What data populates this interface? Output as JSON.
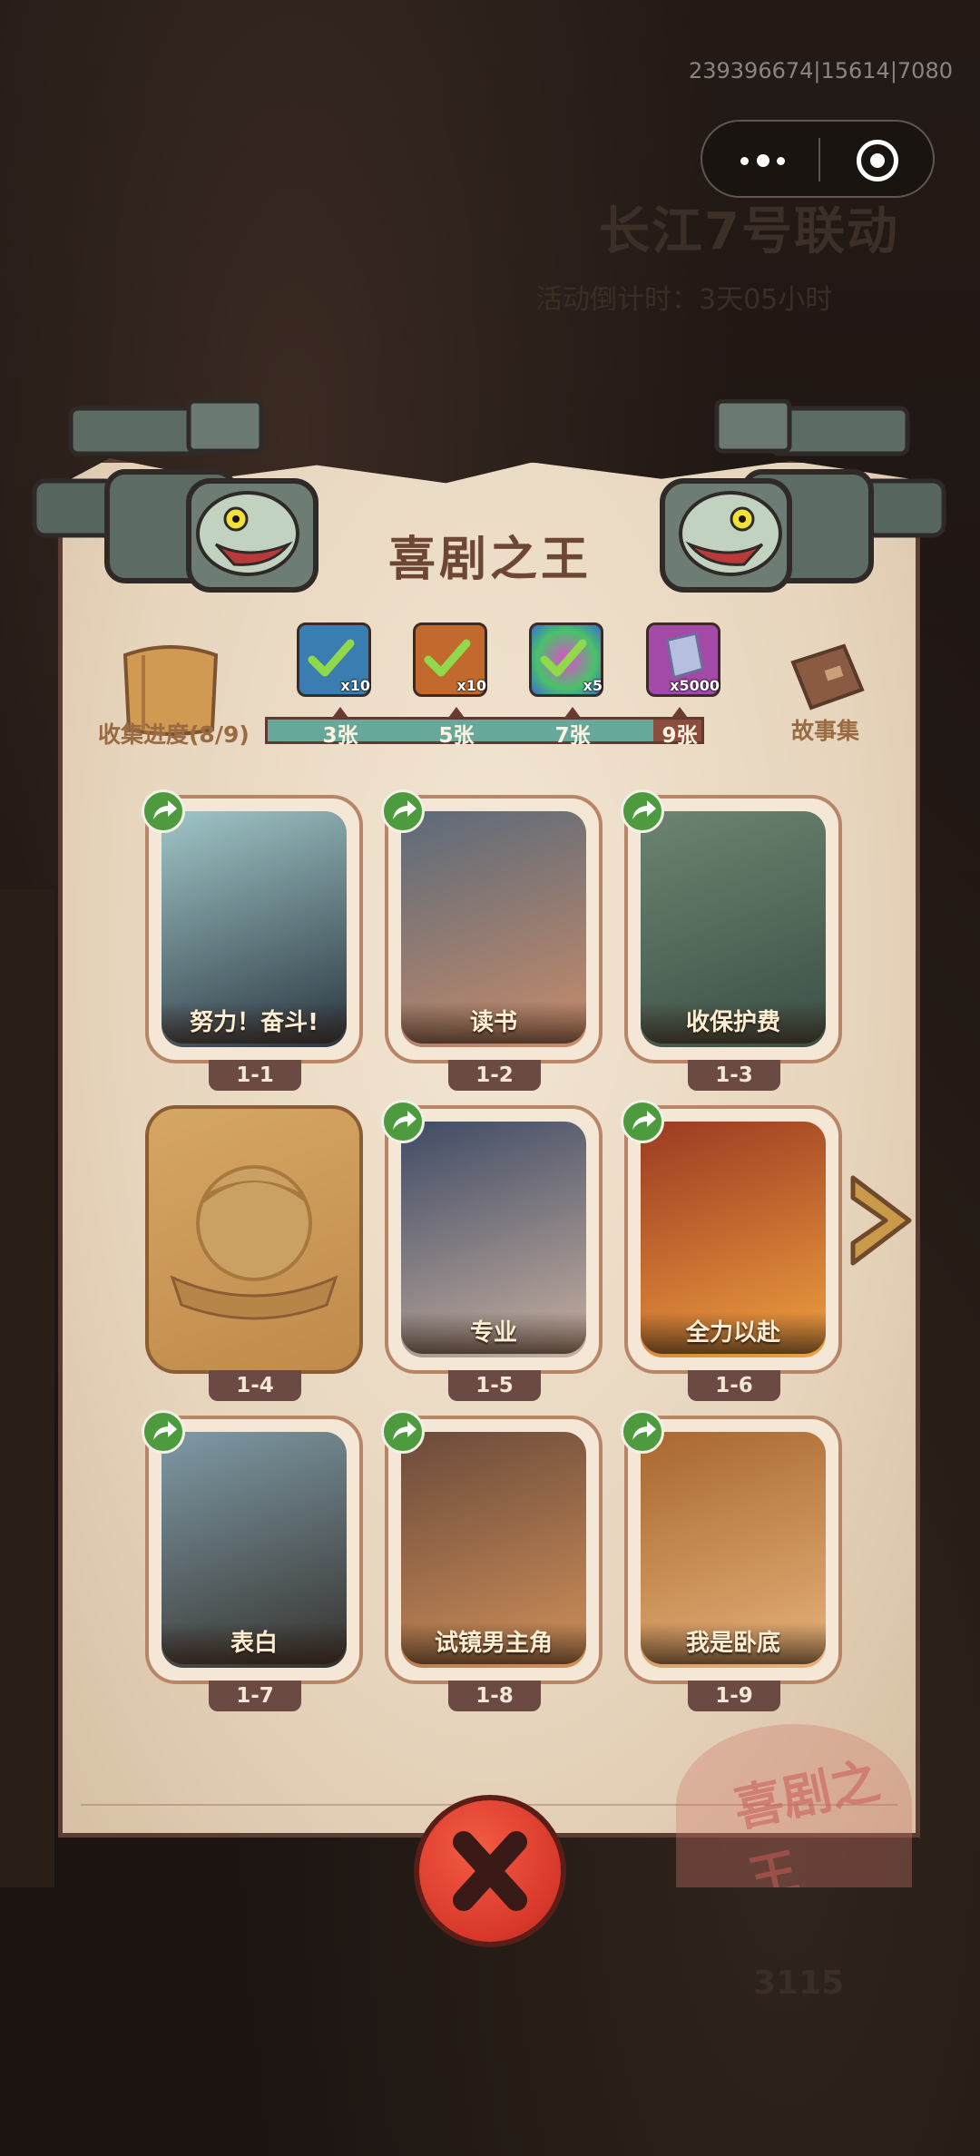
{
  "debug_id": "239396674|15614|7080",
  "background": {
    "event_title": "长江7号联动",
    "event_subtitle": "活动倒计时：3天05小时",
    "score": "3115"
  },
  "dialog": {
    "title": "喜剧之王",
    "progress_label": "收集进度(8/9)",
    "story_label": "故事集",
    "progress_fraction": 0.889,
    "milestones": [
      {
        "label": "3张",
        "reward_qty": "x10",
        "reward": "blue-crate",
        "claimed": true
      },
      {
        "label": "5张",
        "reward_qty": "x10",
        "reward": "orange-chest",
        "claimed": true
      },
      {
        "label": "7张",
        "reward_qty": "x5",
        "reward": "rainbow-orb",
        "claimed": true
      },
      {
        "label": "9张",
        "reward_qty": "x5000",
        "reward": "crystal",
        "claimed": false
      }
    ],
    "cards": [
      {
        "id": "1-1",
        "title": "努力！奋斗!",
        "unlocked": true
      },
      {
        "id": "1-2",
        "title": "读书",
        "unlocked": true
      },
      {
        "id": "1-3",
        "title": "收保护费",
        "unlocked": true
      },
      {
        "id": "1-4",
        "title": "",
        "unlocked": false
      },
      {
        "id": "1-5",
        "title": "专业",
        "unlocked": true
      },
      {
        "id": "1-6",
        "title": "全力以赴",
        "unlocked": true
      },
      {
        "id": "1-7",
        "title": "表白",
        "unlocked": true
      },
      {
        "id": "1-8",
        "title": "试镜男主角",
        "unlocked": true
      },
      {
        "id": "1-9",
        "title": "我是卧底",
        "unlocked": true
      }
    ],
    "stamp_text": "喜剧之王"
  },
  "icons": {
    "share": "share-arrow-icon",
    "next": "chevron-right-icon",
    "close": "close-x-icon",
    "capsule_more": "more-dots-icon",
    "capsule_close": "target-close-icon"
  }
}
